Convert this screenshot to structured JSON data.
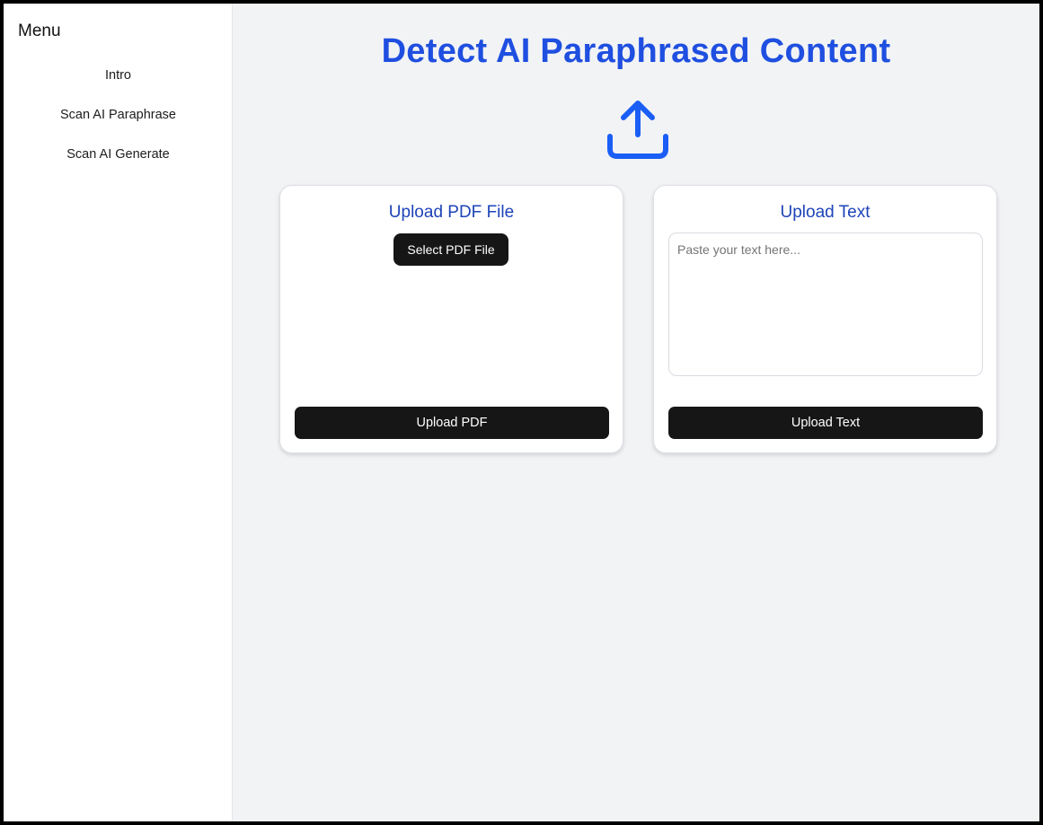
{
  "sidebar": {
    "title": "Menu",
    "items": [
      {
        "label": "Intro"
      },
      {
        "label": "Scan AI Paraphrase"
      },
      {
        "label": "Scan AI Generate"
      }
    ]
  },
  "main": {
    "title": "Detect AI Paraphrased Content",
    "hero_icon": "upload-icon",
    "pdf_card": {
      "title": "Upload PDF File",
      "select_label": "Select PDF File",
      "upload_label": "Upload PDF"
    },
    "text_card": {
      "title": "Upload Text",
      "placeholder": "Paste your text here...",
      "value": "",
      "upload_label": "Upload Text"
    }
  },
  "colors": {
    "accent": "#1f4fe0",
    "card_title": "#1e44b8",
    "button": "#161616",
    "background": "#f2f3f5"
  }
}
